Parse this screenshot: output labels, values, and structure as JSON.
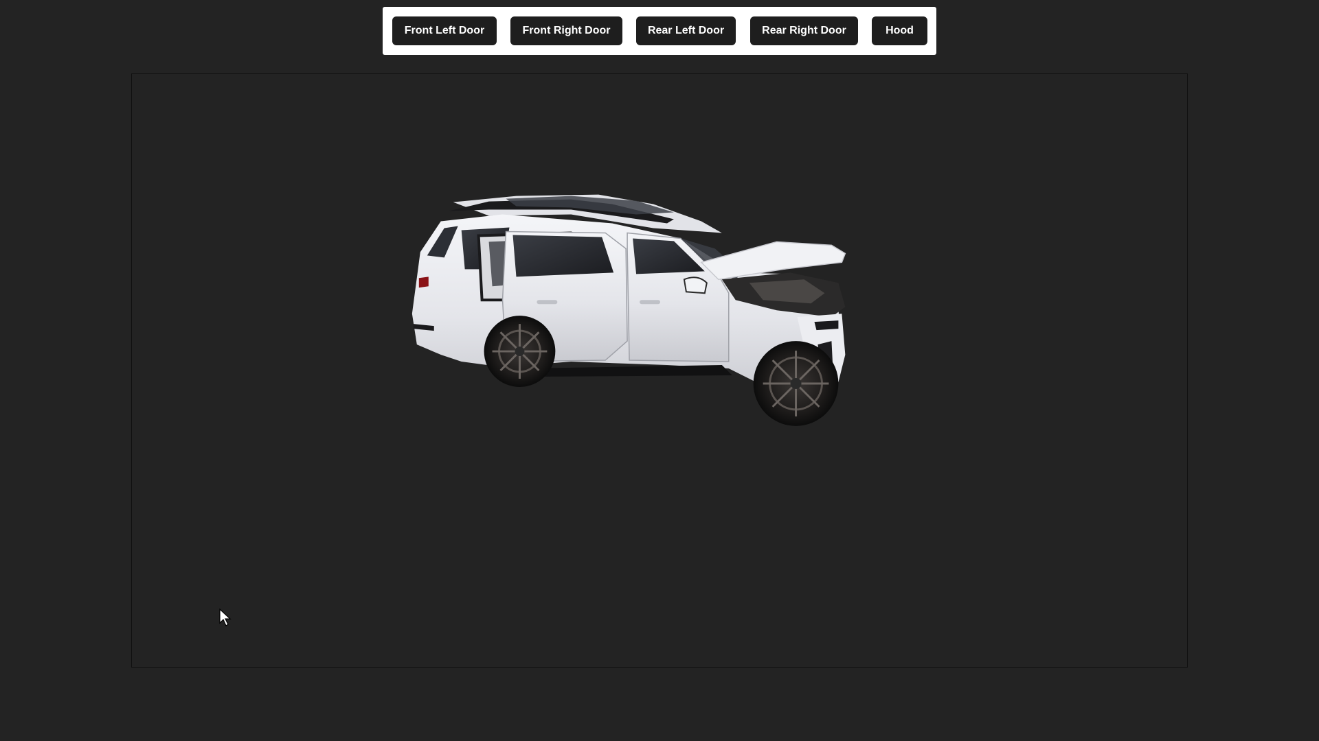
{
  "toolbar": {
    "buttons": [
      {
        "label": "Front Left Door"
      },
      {
        "label": "Front Right Door"
      },
      {
        "label": "Rear Left Door"
      },
      {
        "label": "Rear Right Door"
      },
      {
        "label": "Hood"
      }
    ]
  },
  "viewer": {
    "model": "white-suv-3d-model",
    "state": {
      "front_left_door": "open",
      "hood": "open"
    }
  },
  "colors": {
    "background": "#232323",
    "toolbar_bg": "#ffffff",
    "button_bg": "#1e1e1e",
    "button_text": "#ffffff",
    "car_body": "#e9eaee"
  },
  "cursor": {
    "icon": "arrow-cursor-icon"
  }
}
